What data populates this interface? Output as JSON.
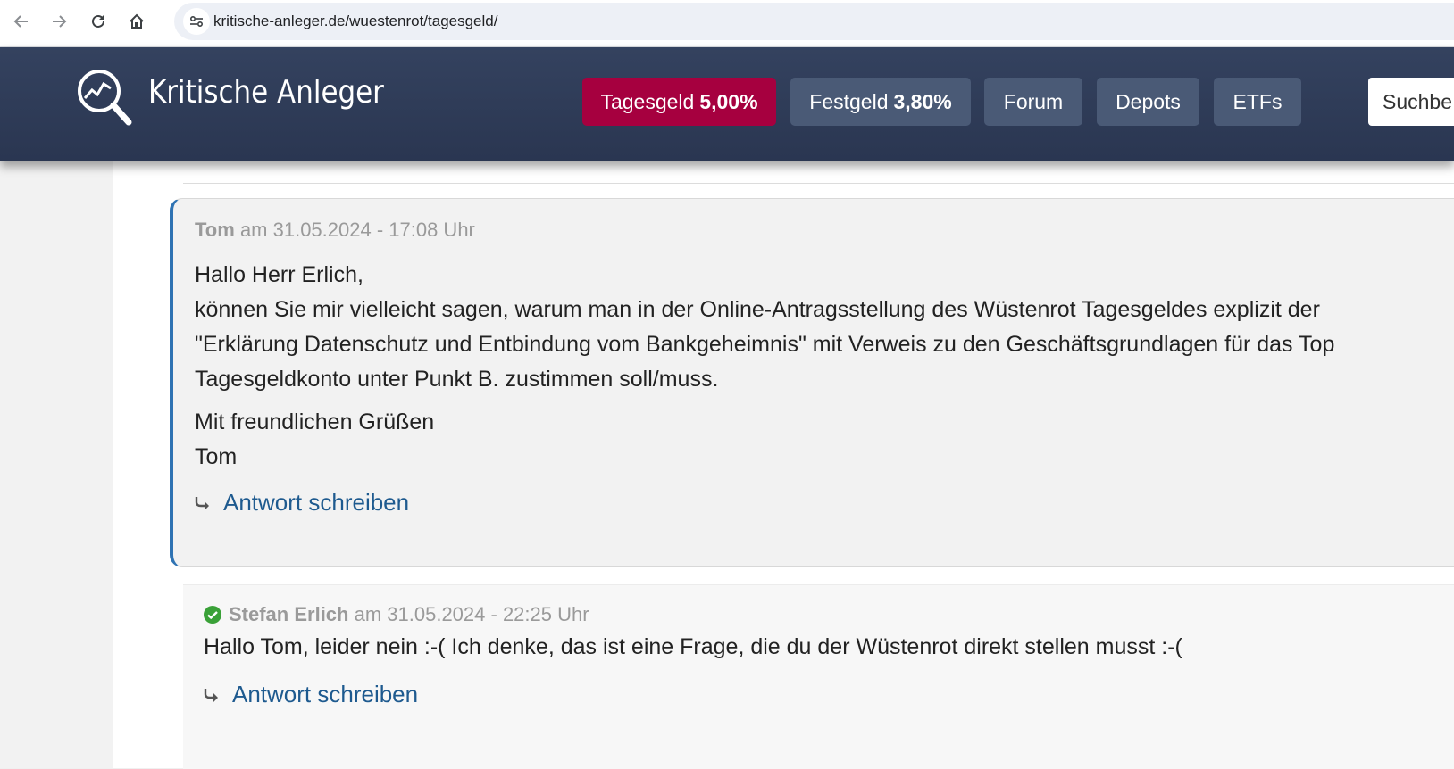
{
  "browser": {
    "url": "kritische-anleger.de/wuestenrot/tagesgeld/"
  },
  "header": {
    "logo_text": "Kritische Anleger",
    "nav": [
      {
        "label": "Tagesgeld",
        "value": "5,00%",
        "active": true
      },
      {
        "label": "Festgeld",
        "value": "3,80%",
        "active": false
      },
      {
        "label": "Forum"
      },
      {
        "label": "Depots"
      },
      {
        "label": "ETFs"
      }
    ],
    "search_placeholder": "Suchbe"
  },
  "comments": [
    {
      "author": "Tom",
      "date": "am 31.05.2024 - 17:08 Uhr",
      "paragraph1": [
        "Hallo Herr Erlich,",
        "können Sie mir vielleicht sagen, warum man in der Online-Antragsstellung des Wüstenrot Tagesgeldes explizit der",
        "\"Erklärung Datenschutz und Entbindung vom Bankgeheimnis\" mit Verweis zu den Geschäftsgrundlagen für das Top",
        "Tagesgeldkonto unter Punkt B. zustimmen soll/muss."
      ],
      "paragraph2": [
        "Mit freundlichen Grüßen",
        "Tom"
      ],
      "reply_label": "Antwort schreiben"
    },
    {
      "author": "Stefan Erlich",
      "verified": true,
      "date": "am 31.05.2024 - 22:25 Uhr",
      "text": "Hallo Tom, leider nein :-( Ich denke, das ist eine Frage, die du der Wüstenrot direkt stellen musst :-(",
      "reply_label": "Antwort schreiben"
    }
  ],
  "colors": {
    "header_bg": "#2e3a56",
    "active_nav": "#a6003f",
    "nav_pill": "#4a5a76",
    "link": "#1e5a8f",
    "comment_accent": "#2f73b3",
    "verified": "#3aa138"
  }
}
